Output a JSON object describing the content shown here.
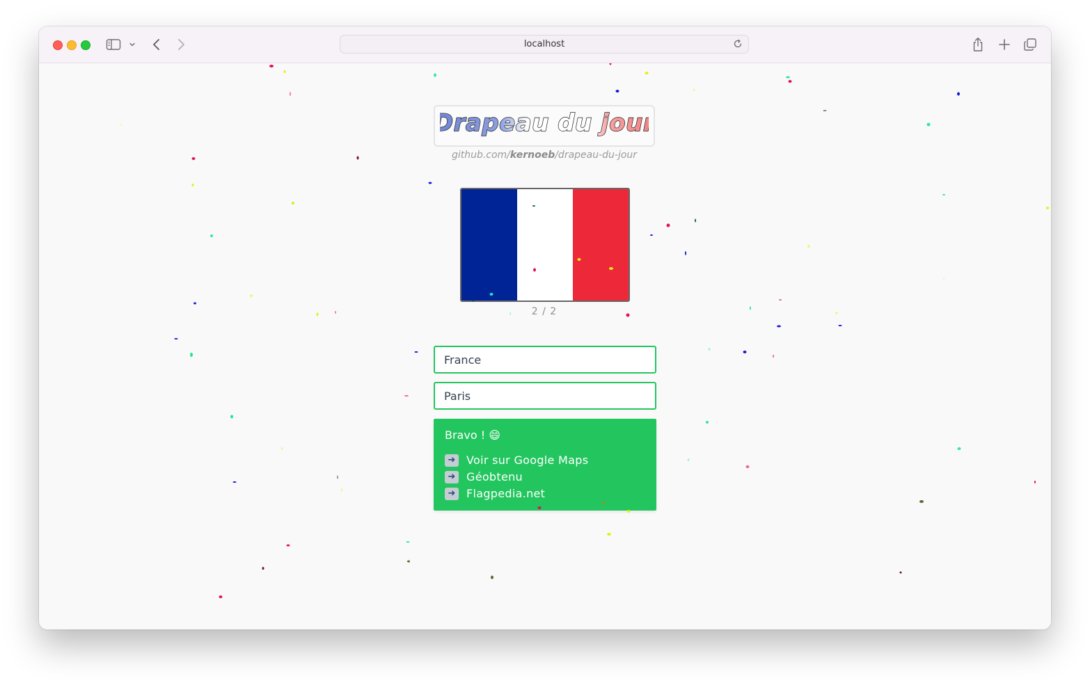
{
  "browser": {
    "url": "localhost"
  },
  "app": {
    "title_parts": [
      "Drap",
      "eau ",
      "du ",
      "jour"
    ],
    "repo_prefix": "github.com/",
    "repo_user": "kernoeb",
    "repo_suffix": "/drapeau-du-jour",
    "counter": "2 / 2"
  },
  "flag": {
    "country": "France",
    "colors": [
      "#002395",
      "#ffffff",
      "#ed2939"
    ]
  },
  "form": {
    "country_value": "France",
    "capital_value": "Paris"
  },
  "result": {
    "message": "Bravo ! 😄",
    "links": [
      "Voir sur Google Maps",
      "Géobtenu",
      "Flagpedia.net"
    ]
  },
  "colors": {
    "success": "#22c55e",
    "title_blue": "#7b8fd6",
    "title_red": "#f08a8a"
  }
}
